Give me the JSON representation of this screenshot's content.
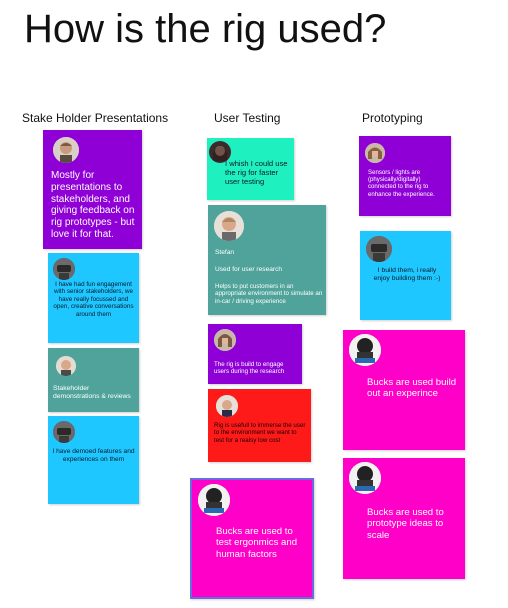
{
  "page": {
    "title": "How is the rig used?"
  },
  "columns": {
    "stakeholder": "Stake Holder Presentations",
    "user_testing": "User Testing",
    "prototyping": "Prototyping"
  },
  "notes": {
    "n1": {
      "text": "Mostly for presentations to stakeholders,  and giving feedback on rig prototypes - but love it for that.",
      "color": "#8f00d6",
      "text_color": "#ffffff",
      "avatar": "man-face-avatar"
    },
    "n2": {
      "text": "I have had fun engagement with senior stakeholders, we have really focussed and open, creative conversations around them",
      "color": "#1ec7ff",
      "text_color": "#0a1a2a",
      "avatar": "vr-headset-avatar"
    },
    "n3": {
      "text": "Stakeholder demonstrations & reviews",
      "color": "#4fa39b",
      "text_color": "#ffffff",
      "avatar": "man-face-avatar"
    },
    "n4": {
      "text": "I have demoed features and experiences on them",
      "color": "#1ec7ff",
      "text_color": "#0a1a2a",
      "avatar": "vr-headset-avatar"
    },
    "n5": {
      "text": "I whish I could use the rig for faster user testing",
      "color": "#1ff0c0",
      "text_color": "#0a1a2a",
      "avatar": "woman-face-avatar"
    },
    "n6": {
      "name": "Stefan",
      "line1": "Used for user research",
      "line2": "Helps to put customers in an appropriate environment to simulate an in-car / driving experience",
      "color": "#4fa39b",
      "text_color": "#ffffff",
      "avatar": "man-face-avatar"
    },
    "n7": {
      "text": "The rig is build to engage users during the research",
      "color": "#8f00d6",
      "text_color": "#ffffff",
      "avatar": "woman-face-avatar"
    },
    "n8": {
      "text": "Rig is usefull to immerse the user to the environment we want to test for a realsy low cost",
      "color": "#ff1a1a",
      "text_color": "#1a0000",
      "avatar": "man-face-avatar"
    },
    "n9": {
      "text": "Bucks are used to test ergonmics and human factors",
      "color": "#ff00c8",
      "text_color": "#ffffff",
      "avatar": "head-avatar"
    },
    "n10": {
      "text": "Sensors / lights are (physically/digitally) connected to the rig to enhance the experience.",
      "color": "#8f00d6",
      "text_color": "#ffffff",
      "avatar": "woman-face-avatar"
    },
    "n11": {
      "text": "I build them, i really enjoy building them :-)",
      "color": "#1ec7ff",
      "text_color": "#0a1a2a",
      "avatar": "vr-headset-avatar"
    },
    "n12": {
      "text": "Bucks are used build out an experince",
      "color": "#ff00c8",
      "text_color": "#ffffff",
      "avatar": "head-avatar"
    },
    "n13": {
      "text": "Bucks are used to prototype ideas to scale",
      "color": "#ff00c8",
      "text_color": "#ffffff",
      "avatar": "head-avatar"
    }
  }
}
